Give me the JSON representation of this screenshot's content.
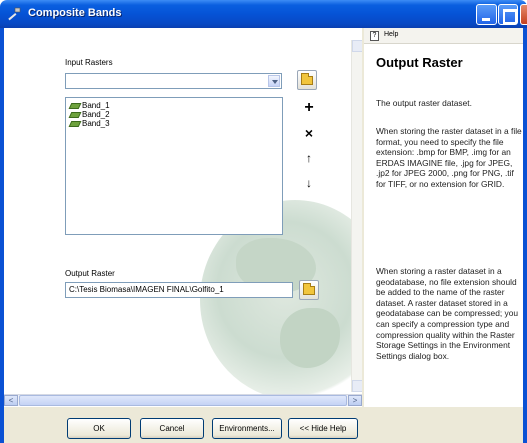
{
  "window": {
    "title": "Composite Bands",
    "icon": "tool-hammer-icon"
  },
  "form": {
    "input_rasters_label": "Input Rasters",
    "input_rasters_value": "",
    "bands": [
      "Band_1",
      "Band_2",
      "Band_3"
    ],
    "side_buttons": {
      "add": "+",
      "remove": "×",
      "up": "↑",
      "down": "↓"
    },
    "output_raster_label": "Output Raster",
    "output_raster_value": "C:\\Tesis Biomasa\\IMAGEN FINAL\\Golfito_1"
  },
  "buttons": {
    "ok": "OK",
    "cancel": "Cancel",
    "environments": "Environments...",
    "hide_help": "<< Hide Help"
  },
  "help": {
    "header": "Help",
    "title": "Output Raster",
    "paragraphs": [
      "The output raster dataset.",
      "When storing the raster dataset in a file format, you need to specify the file extension: .bmp for BMP, .img for an ERDAS IMAGINE file, .jpg for JPEG, .jp2 for JPEG 2000, .png for PNG, .tif for TIFF, or no extension for GRID.",
      "When storing a raster dataset in a geodatabase, no file extension should be added to the name of the raster dataset. A raster dataset stored in a geodatabase can be compressed; you can specify a compression type and compression quality within the Raster Storage Settings in the Environment Settings dialog box."
    ]
  },
  "scrollbars": {
    "left_arrow": "<",
    "right_arrow": ">"
  }
}
